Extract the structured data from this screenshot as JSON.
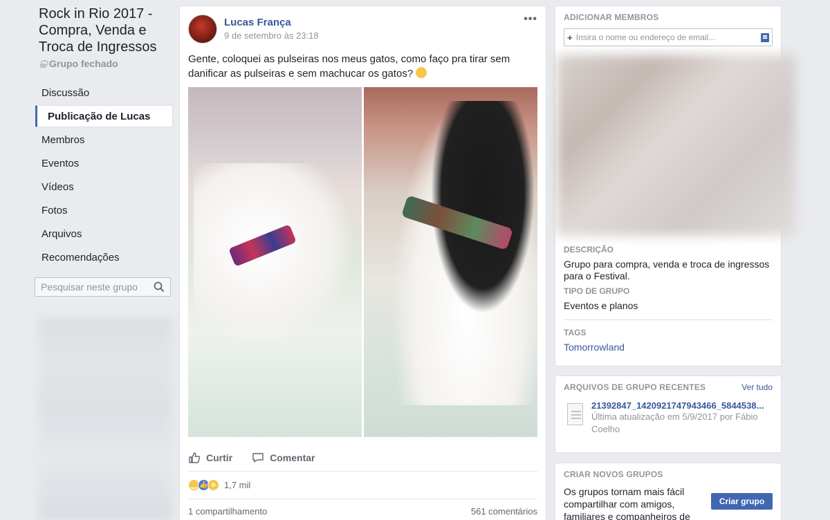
{
  "group": {
    "title": "Rock in Rio 2017 - Compra, Venda e Troca de Ingressos",
    "status": "Grupo fechado"
  },
  "nav": {
    "items": [
      {
        "label": "Discussão",
        "active": false
      },
      {
        "label": "Publicação de Lucas",
        "active": true
      },
      {
        "label": "Membros",
        "active": false
      },
      {
        "label": "Eventos",
        "active": false
      },
      {
        "label": "Vídeos",
        "active": false
      },
      {
        "label": "Fotos",
        "active": false
      },
      {
        "label": "Arquivos",
        "active": false
      },
      {
        "label": "Recomendações",
        "active": false
      }
    ],
    "search_placeholder": "Pesquisar neste grupo"
  },
  "post": {
    "author": "Lucas França",
    "timestamp": "9 de setembro às 23:18",
    "text": "Gente, coloquei as pulseiras nos meus gatos, como faço pra tirar sem danificar as pulseiras e sem machucar os gatos?",
    "actions": {
      "like": "Curtir",
      "comment": "Comentar"
    },
    "reaction_count": "1,7 mil",
    "shares": "1 compartilhamento",
    "comments": "561 comentários"
  },
  "sidebar": {
    "add_members": {
      "heading": "ADICIONAR MEMBROS",
      "placeholder": "Insira o nome ou endereço de email..."
    },
    "description": {
      "label": "DESCRIÇÃO",
      "value": "Grupo para compra, venda e troca de ingressos para o Festival."
    },
    "group_type": {
      "label": "TIPO DE GRUPO",
      "value": "Eventos e planos"
    },
    "tags": {
      "label": "TAGS",
      "value": "Tomorrowland"
    },
    "files": {
      "heading": "ARQUIVOS DE GRUPO RECENTES",
      "see_all": "Ver tudo",
      "file_name": "21392847_1420921747943466_5844538...",
      "file_meta": "Última atualização em 5/9/2017 por Fábio Coelho"
    },
    "create_group": {
      "heading": "CRIAR NOVOS GRUPOS",
      "text": "Os grupos tornam mais fácil compartilhar com amigos, familiares e companheiros de",
      "button": "Criar grupo"
    }
  },
  "colors": {
    "link": "#365899",
    "accent": "#4267b2",
    "background": "#e9ebee"
  }
}
